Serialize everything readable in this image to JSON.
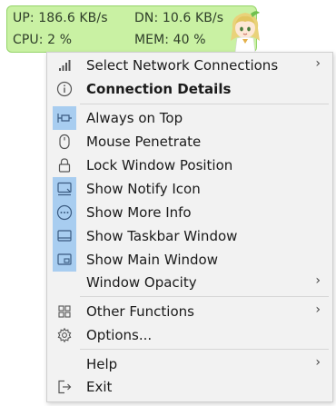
{
  "monitor": {
    "upload": "UP: 186.6 KB/s",
    "download": "DN: 10.6 KB/s",
    "cpu": "CPU: 2 %",
    "memory": "MEM: 40 %",
    "background_color": "#c9f1a3",
    "mascot_icon": "anime-girl-mascot"
  },
  "menu": {
    "items": [
      {
        "label": "Select Network Connections",
        "icon": "signal-bars-icon",
        "submenu": true
      },
      {
        "label": "Connection Details",
        "icon": "info-icon",
        "bold": true
      },
      {
        "label": "Always on Top",
        "icon": "pin-icon",
        "checked": true
      },
      {
        "label": "Mouse Penetrate",
        "icon": "mouse-icon"
      },
      {
        "label": "Lock Window Position",
        "icon": "lock-icon"
      },
      {
        "label": "Show Notify Icon",
        "icon": "notify-icon",
        "checked": true
      },
      {
        "label": "Show More Info",
        "icon": "more-icon",
        "checked": true
      },
      {
        "label": "Show Taskbar Window",
        "icon": "taskbar-window-icon",
        "checked": true
      },
      {
        "label": "Show Main Window",
        "icon": "main-window-icon",
        "checked": true
      },
      {
        "label": "Window Opacity",
        "icon": "",
        "submenu": true
      },
      {
        "label": "Other Functions",
        "icon": "grid-icon",
        "submenu": true
      },
      {
        "label": "Options...",
        "icon": "gear-icon"
      },
      {
        "label": "Help",
        "icon": "",
        "submenu": true
      },
      {
        "label": "Exit",
        "icon": "exit-icon"
      }
    ],
    "submenu_arrow": "›",
    "checked_color": "#a8cdf0"
  }
}
